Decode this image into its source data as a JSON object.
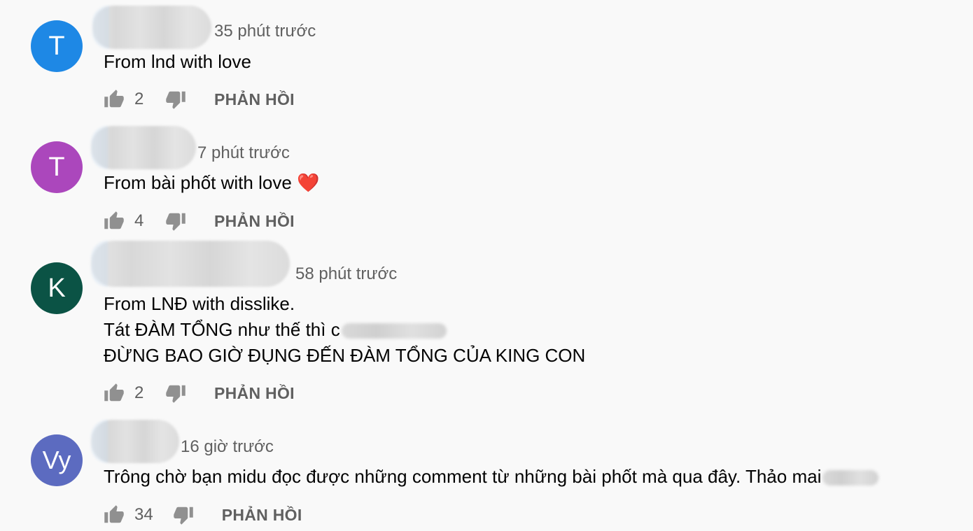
{
  "comments": [
    {
      "avatar_letter": "T",
      "avatar_color": "#1e88e5",
      "timestamp": "35 phút trước",
      "lines": [
        "From lnd with love"
      ],
      "likes": "2",
      "reply_label": "PHẢN HỒI"
    },
    {
      "avatar_letter": "T",
      "avatar_color": "#ab47bc",
      "timestamp": "7 phút trước",
      "lines": [
        "From bài phốt with love"
      ],
      "emoji": "❤️",
      "likes": "4",
      "reply_label": "PHẢN HỒI"
    },
    {
      "avatar_letter": "K",
      "avatar_color": "#0b5345",
      "timestamp": "58 phút trước",
      "lines": [
        "From LNĐ with disslike.",
        "Tát ĐÀM TỔNG như thế thì c",
        "ĐỪNG BAO GIỜ ĐỤNG ĐẾN ĐÀM TỔNG CỦA KING CON"
      ],
      "likes": "2",
      "reply_label": "PHẢN HỒI"
    },
    {
      "avatar_letter": "Vy",
      "avatar_color": "#5c6bc0",
      "timestamp": "16 giờ trước",
      "lines": [
        "Trông chờ bạn midu đọc được những comment từ những bài phốt mà qua đây. Thảo mai"
      ],
      "likes": "34",
      "reply_label": "PHẢN HỒI"
    }
  ],
  "icons": {
    "like": "thumb-up-icon",
    "dislike": "thumb-down-icon"
  }
}
